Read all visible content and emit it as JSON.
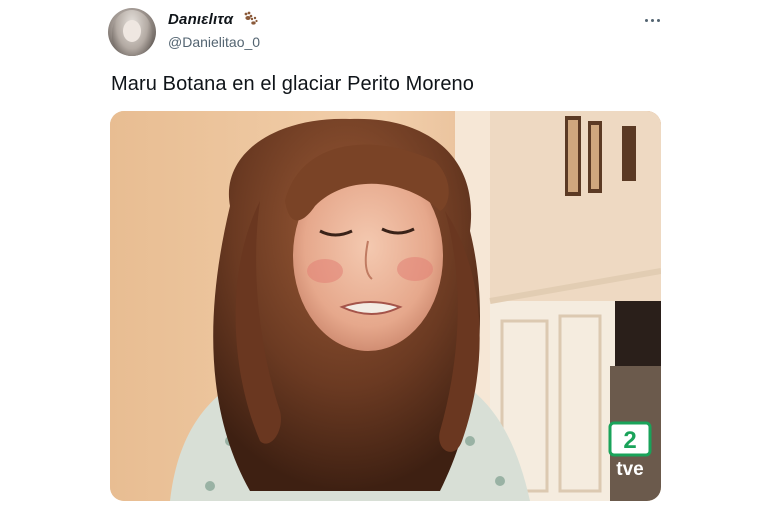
{
  "tweet": {
    "display_name": "Danιεlιτα",
    "handle": "@Danielitao_0",
    "text": "Maru Botana en el glaciar Perito Moreno",
    "media": {
      "watermark_number": "2",
      "watermark_text": "tve"
    }
  },
  "icons": {
    "author_emoji": "paw-prints-icon",
    "menu": "more-options-icon"
  },
  "colors": {
    "text_primary": "#0f1419",
    "text_secondary": "#536471",
    "watermark_green": "#1aa35a"
  }
}
